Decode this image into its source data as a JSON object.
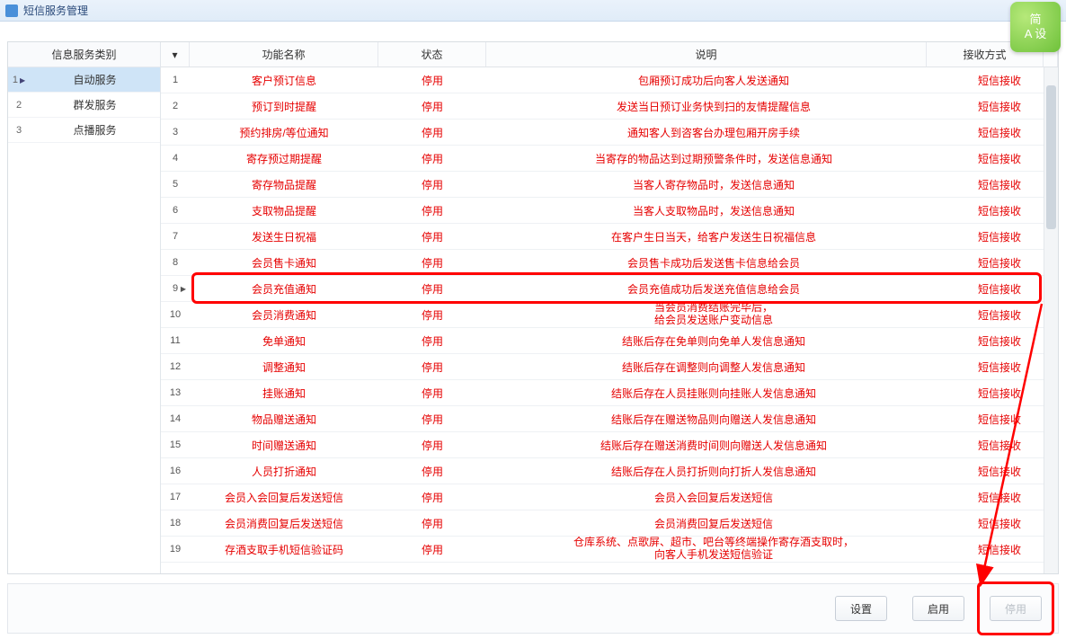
{
  "window": {
    "title": "短信服务管理"
  },
  "badge": {
    "line1": "简",
    "line2": "A 设"
  },
  "sidebar": {
    "header": "信息服务类别",
    "items": [
      {
        "idx": "1",
        "label": "自动服务",
        "selected": true
      },
      {
        "idx": "2",
        "label": "群发服务",
        "selected": false
      },
      {
        "idx": "3",
        "label": "点播服务",
        "selected": false
      }
    ]
  },
  "grid": {
    "headers": {
      "name": "功能名称",
      "state": "状态",
      "desc": "说明",
      "recv": "接收方式"
    },
    "rows": [
      {
        "idx": "1",
        "name": "客户预订信息",
        "state": "停用",
        "desc": "包厢预订成功后向客人发送通知",
        "recv": "短信接收"
      },
      {
        "idx": "2",
        "name": "预订到时提醒",
        "state": "停用",
        "desc": "发送当日预订业务快到扫的友情提醒信息",
        "recv": "短信接收"
      },
      {
        "idx": "3",
        "name": "预约排房/等位通知",
        "state": "停用",
        "desc": "通知客人到咨客台办理包厢开房手续",
        "recv": "短信接收"
      },
      {
        "idx": "4",
        "name": "寄存预过期提醒",
        "state": "停用",
        "desc": "当寄存的物品达到过期预警条件时，发送信息通知",
        "recv": "短信接收"
      },
      {
        "idx": "5",
        "name": "寄存物品提醒",
        "state": "停用",
        "desc": "当客人寄存物品时，发送信息通知",
        "recv": "短信接收"
      },
      {
        "idx": "6",
        "name": "支取物品提醒",
        "state": "停用",
        "desc": "当客人支取物品时，发送信息通知",
        "recv": "短信接收"
      },
      {
        "idx": "7",
        "name": "发送生日祝福",
        "state": "停用",
        "desc": "在客户生日当天，给客户发送生日祝福信息",
        "recv": "短信接收"
      },
      {
        "idx": "8",
        "name": "会员售卡通知",
        "state": "停用",
        "desc": "会员售卡成功后发送售卡信息给会员",
        "recv": "短信接收"
      },
      {
        "idx": "9",
        "name": "会员充值通知",
        "state": "停用",
        "desc": "会员充值成功后发送充值信息给会员",
        "recv": "短信接收",
        "selected": true
      },
      {
        "idx": "10",
        "name": "会员消费通知",
        "state": "停用",
        "desc": "当会员消费结账完毕后，给会员发送账户变动信息",
        "recv": "短信接收",
        "twoLine": true
      },
      {
        "idx": "11",
        "name": "免单通知",
        "state": "停用",
        "desc": "结账后存在免单则向免单人发信息通知",
        "recv": "短信接收"
      },
      {
        "idx": "12",
        "name": "调整通知",
        "state": "停用",
        "desc": "结账后存在调整则向调整人发信息通知",
        "recv": "短信接收"
      },
      {
        "idx": "13",
        "name": "挂账通知",
        "state": "停用",
        "desc": "结账后存在人员挂账则向挂账人发信息通知",
        "recv": "短信接收"
      },
      {
        "idx": "14",
        "name": "物品赠送通知",
        "state": "停用",
        "desc": "结账后存在赠送物品则向赠送人发信息通知",
        "recv": "短信接收"
      },
      {
        "idx": "15",
        "name": "时间赠送通知",
        "state": "停用",
        "desc": "结账后存在赠送消费时间则向赠送人发信息通知",
        "recv": "短信接收"
      },
      {
        "idx": "16",
        "name": "人员打折通知",
        "state": "停用",
        "desc": "结账后存在人员打折则向打折人发信息通知",
        "recv": "短信接收"
      },
      {
        "idx": "17",
        "name": "会员入会回复后发送短信",
        "state": "停用",
        "desc": "会员入会回复后发送短信",
        "recv": "短信接收"
      },
      {
        "idx": "18",
        "name": "会员消费回复后发送短信",
        "state": "停用",
        "desc": "会员消费回复后发送短信",
        "recv": "短信接收"
      },
      {
        "idx": "19",
        "name": "存酒支取手机短信验证码",
        "state": "停用",
        "desc": "仓库系统、点歌屏、超市、吧台等终端操作寄存酒支取时，向客人手机发送短信验证",
        "recv": "短信接收",
        "twoLine": true
      }
    ]
  },
  "footer": {
    "btnSettings": "设置",
    "btnEnable": "启用",
    "btnDisable": "停用"
  }
}
